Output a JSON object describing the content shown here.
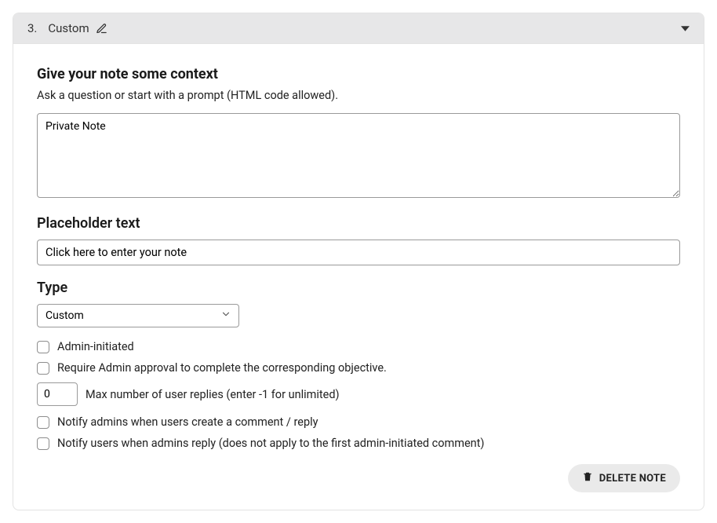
{
  "header": {
    "number": "3.",
    "title": "Custom"
  },
  "context": {
    "heading": "Give your note some context",
    "description": "Ask a question or start with a prompt (HTML code allowed).",
    "textarea_value": "Private Note"
  },
  "placeholder": {
    "heading": "Placeholder text",
    "value": "Click here to enter your note"
  },
  "type": {
    "heading": "Type",
    "selected": "Custom"
  },
  "options": {
    "admin_initiated_label": "Admin-initiated",
    "require_approval_label": "Require Admin approval to complete the corresponding objective.",
    "max_replies_value": "0",
    "max_replies_label": "Max number of user replies (enter -1 for unlimited)",
    "notify_admins_label": "Notify admins when users create a comment / reply",
    "notify_users_label": "Notify users when admins reply (does not apply to the first admin-initiated comment)"
  },
  "actions": {
    "delete_label": "DELETE NOTE"
  }
}
